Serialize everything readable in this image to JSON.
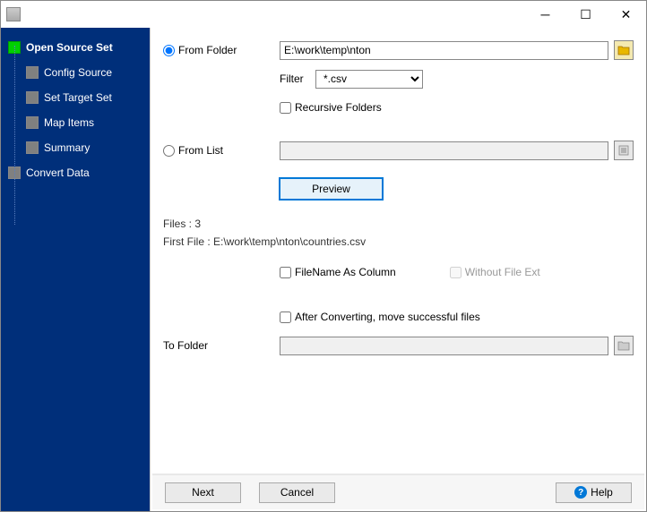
{
  "sidebar": {
    "items": [
      {
        "label": "Open Source Set",
        "level": 1,
        "active": true
      },
      {
        "label": "Config Source",
        "level": 2,
        "active": false
      },
      {
        "label": "Set Target Set",
        "level": 2,
        "active": false
      },
      {
        "label": "Map Items",
        "level": 2,
        "active": false
      },
      {
        "label": "Summary",
        "level": 2,
        "active": false
      },
      {
        "label": "Convert Data",
        "level": 1,
        "active": false
      }
    ]
  },
  "form": {
    "from_folder_label": "From Folder",
    "from_folder_value": "E:\\work\\temp\\nton",
    "filter_label": "Filter",
    "filter_value": "*.csv",
    "recursive_label": "Recursive Folders",
    "from_list_label": "From List",
    "from_list_value": "",
    "preview_label": "Preview",
    "files_count_label": "Files : 3",
    "first_file_label": "First File : E:\\work\\temp\\nton\\countries.csv",
    "filename_col_label": "FileName As Column",
    "without_ext_label": "Without File Ext",
    "after_convert_label": "After Converting, move successful files",
    "to_folder_label": "To Folder",
    "to_folder_value": ""
  },
  "footer": {
    "next": "Next",
    "cancel": "Cancel",
    "help": "Help"
  }
}
